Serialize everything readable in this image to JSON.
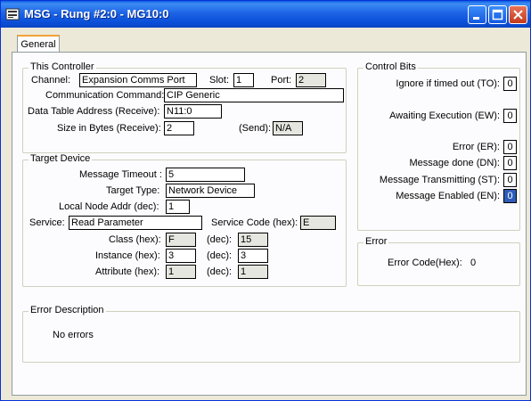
{
  "window": {
    "title": "MSG - Rung #2:0 - MG10:0"
  },
  "tabs": [
    {
      "label": "General"
    }
  ],
  "this_controller": {
    "title": "This Controller",
    "channel_label": "Channel:",
    "channel_value": "Expansion Comms Port",
    "slot_label": "Slot:",
    "slot_value": "1",
    "port_label": "Port:",
    "port_value": "2",
    "comm_command_label": "Communication Command:",
    "comm_command_value": "CIP Generic",
    "data_table_label": "Data Table Address (Receive):",
    "data_table_value": "N11:0",
    "size_label": "Size in Bytes (Receive):",
    "size_value": "2",
    "send_label": "(Send):",
    "send_value": "N/A"
  },
  "target_device": {
    "title": "Target Device",
    "timeout_label": "Message Timeout :",
    "timeout_value": "5",
    "target_type_label": "Target Type:",
    "target_type_value": "Network Device",
    "local_node_label": "Local Node Addr (dec):",
    "local_node_value": "1",
    "service_label": "Service:",
    "service_value": "Read Parameter",
    "service_code_label": "Service Code (hex):",
    "service_code_value": "E",
    "class_label": "Class (hex):",
    "class_hex": "F",
    "class_dec_label": "(dec):",
    "class_dec": "15",
    "instance_label": "Instance (hex):",
    "instance_hex": "3",
    "instance_dec_label": "(dec):",
    "instance_dec": "3",
    "attribute_label": "Attribute (hex):",
    "attribute_hex": "1",
    "attribute_dec_label": "(dec):",
    "attribute_dec": "1"
  },
  "control_bits": {
    "title": "Control Bits",
    "items": [
      {
        "label": "Ignore if timed out (TO):",
        "value": "0"
      },
      {
        "label": "Awaiting Execution (EW):",
        "value": "0"
      },
      {
        "label": "Error (ER):",
        "value": "0"
      },
      {
        "label": "Message done (DN):",
        "value": "0"
      },
      {
        "label": "Message Transmitting (ST):",
        "value": "0"
      },
      {
        "label": "Message Enabled (EN):",
        "value": "0"
      }
    ]
  },
  "error": {
    "title": "Error",
    "code_label": "Error Code(Hex):",
    "code_value": "0"
  },
  "error_description": {
    "title": "Error Description",
    "text": "No errors"
  }
}
